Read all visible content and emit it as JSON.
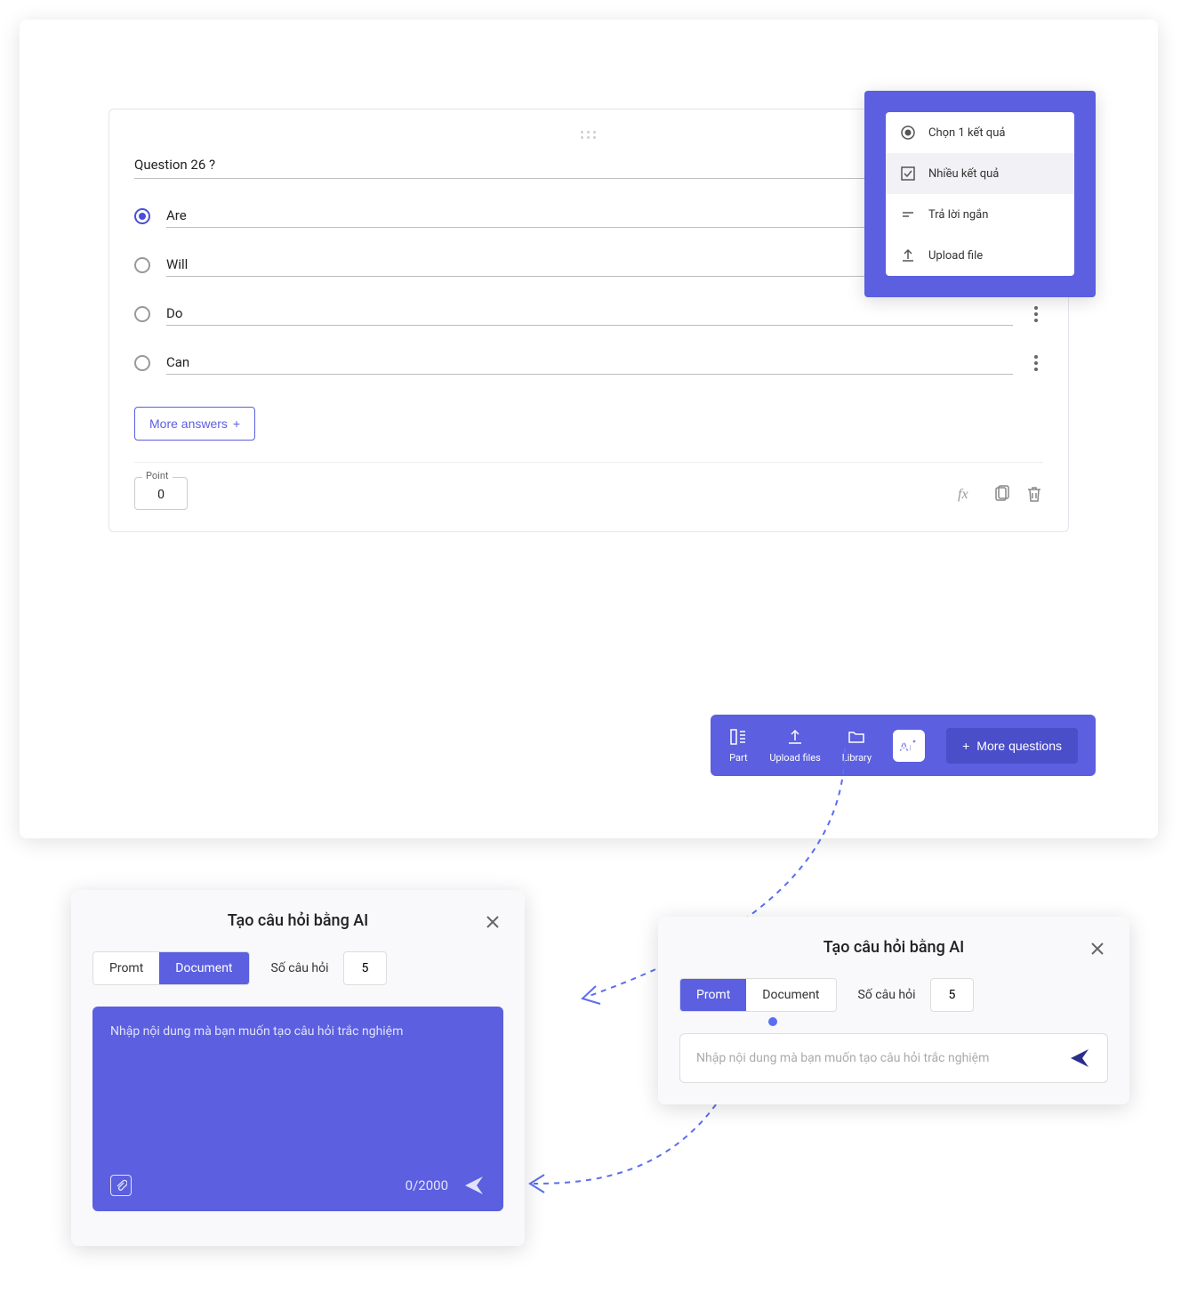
{
  "question": {
    "title": "Question 26 ?",
    "answers": [
      {
        "label": "Are",
        "selected": true
      },
      {
        "label": "Will",
        "selected": false
      },
      {
        "label": "Do",
        "selected": false
      },
      {
        "label": "Can",
        "selected": false
      }
    ],
    "more_answers_label": "More answers",
    "point_label": "Point",
    "point_value": "0"
  },
  "type_menu": {
    "items": [
      {
        "label": "Chọn 1 kết quả",
        "icon": "radio",
        "active": false
      },
      {
        "label": "Nhiều kết quả",
        "icon": "checkbox",
        "active": true
      },
      {
        "label": "Trả lời ngắn",
        "icon": "short-text",
        "active": false
      },
      {
        "label": "Upload file",
        "icon": "upload",
        "active": false
      }
    ]
  },
  "action_bar": {
    "part_label": "Part",
    "upload_label": "Upload files",
    "library_label": "Library",
    "more_questions_label": "More questions"
  },
  "popup": {
    "title": "Tạo câu hỏi bằng AI",
    "tab_promt": "Promt",
    "tab_document": "Document",
    "count_label": "Số câu hỏi",
    "count_value": "5",
    "placeholder": "Nhập nội dung mà bạn muốn tạo câu hỏi trắc nghiệm",
    "char_counter": "0/2000"
  }
}
